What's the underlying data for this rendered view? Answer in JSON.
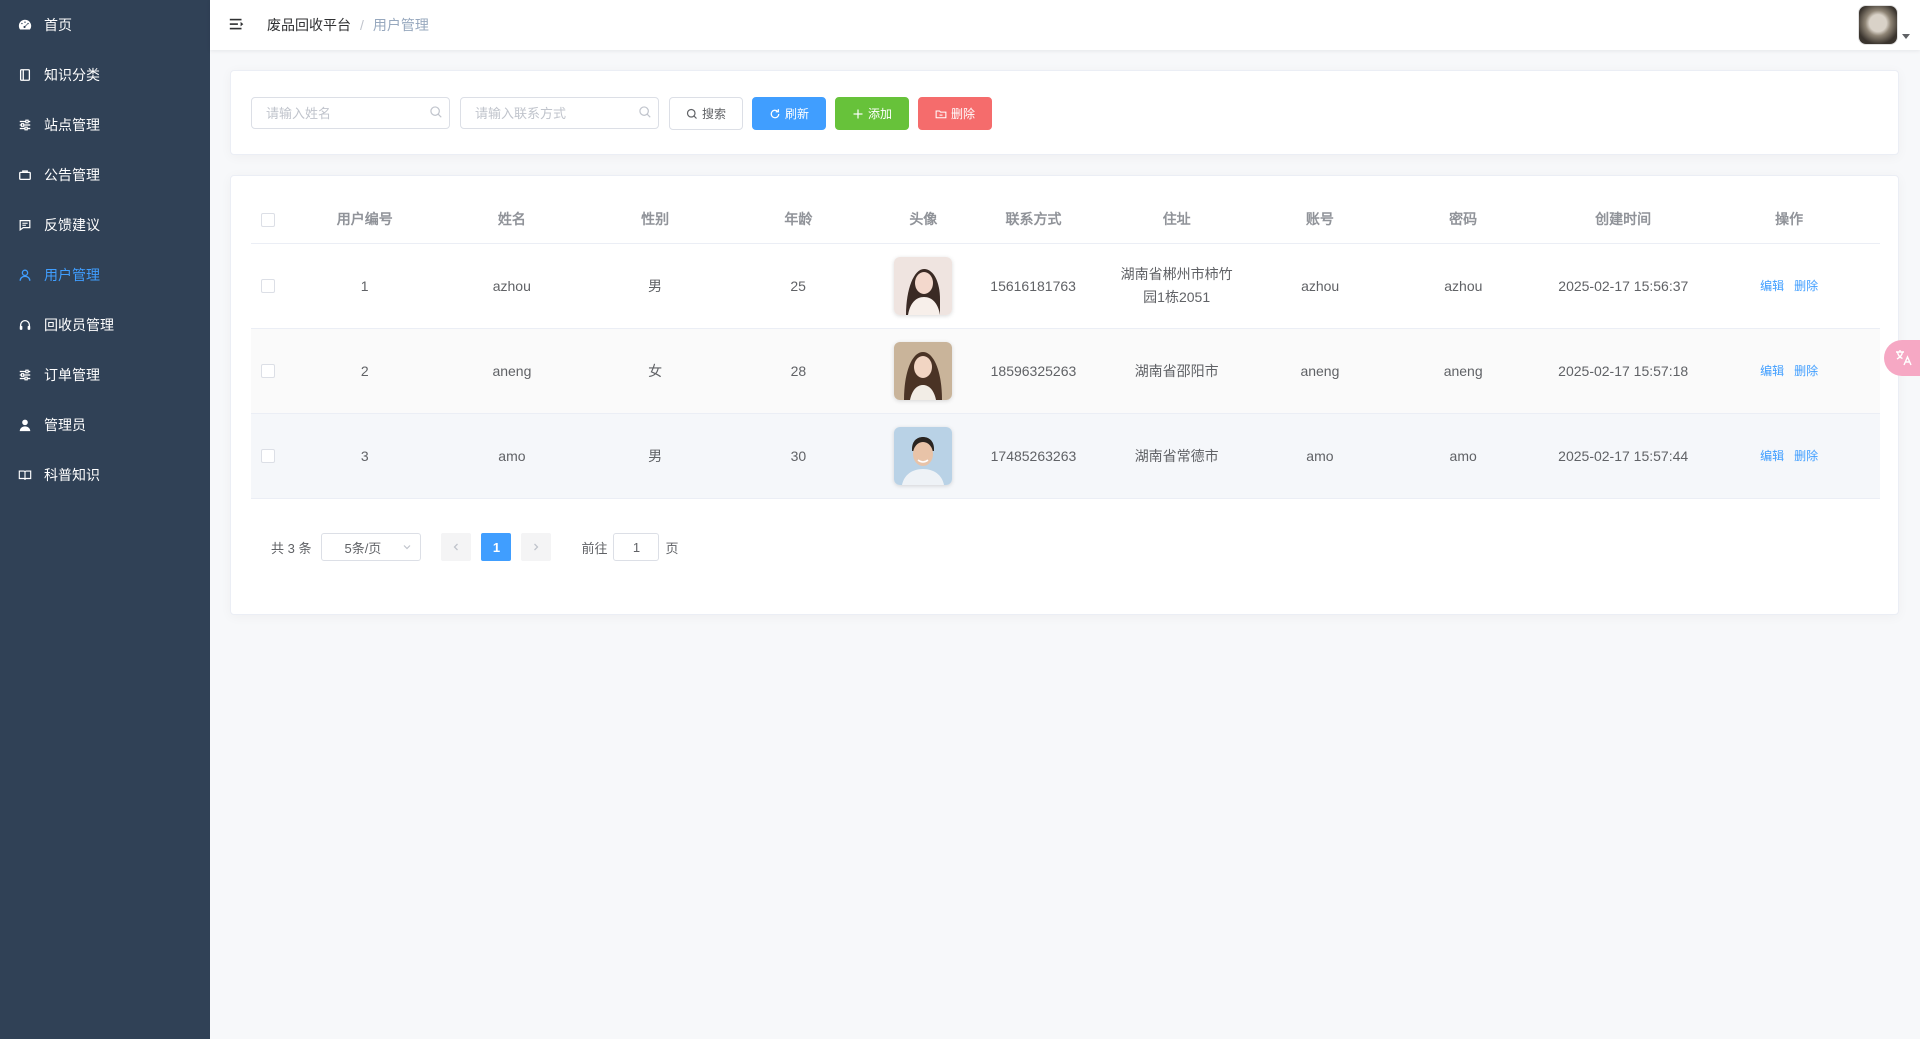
{
  "sidebar": {
    "items": [
      {
        "label": "首页",
        "icon": "dashboard-icon",
        "active": false
      },
      {
        "label": "知识分类",
        "icon": "book-icon",
        "active": false
      },
      {
        "label": "站点管理",
        "icon": "sliders-icon",
        "active": false
      },
      {
        "label": "公告管理",
        "icon": "briefcase-icon",
        "active": false
      },
      {
        "label": "反馈建议",
        "icon": "message-icon",
        "active": false
      },
      {
        "label": "用户管理",
        "icon": "user-icon",
        "active": true
      },
      {
        "label": "回收员管理",
        "icon": "headset-icon",
        "active": false
      },
      {
        "label": "订单管理",
        "icon": "sliders-icon",
        "active": false
      },
      {
        "label": "管理员",
        "icon": "user-solid-icon",
        "active": false
      },
      {
        "label": "科普知识",
        "icon": "open-book-icon",
        "active": false
      }
    ],
    "colors": {
      "bg": "#304156",
      "text": "#ffffff",
      "active": "#409eff"
    }
  },
  "header": {
    "breadcrumb_home": "废品回收平台",
    "breadcrumb_sep": "/",
    "breadcrumb_current": "用户管理"
  },
  "search": {
    "name_placeholder": "请输入姓名",
    "phone_placeholder": "请输入联系方式",
    "search_label": "搜索",
    "refresh_label": "刷新",
    "add_label": "添加",
    "delete_label": "删除"
  },
  "table": {
    "columns": [
      "用户编号",
      "姓名",
      "性别",
      "年龄",
      "头像",
      "联系方式",
      "住址",
      "账号",
      "密码",
      "创建时间",
      "操作"
    ],
    "rows": [
      {
        "id": "1",
        "name": "azhou",
        "gender": "男",
        "age": "25",
        "avatar": "woman-photo-1",
        "phone": "15616181763",
        "address": "湖南省郴州市柿竹园1栋2051",
        "account": "azhou",
        "password": "azhou",
        "created": "2025-02-17 15:56:37",
        "edit": "编辑",
        "del": "删除"
      },
      {
        "id": "2",
        "name": "aneng",
        "gender": "女",
        "age": "28",
        "avatar": "woman-photo-2",
        "phone": "18596325263",
        "address": "湖南省邵阳市",
        "account": "aneng",
        "password": "aneng",
        "created": "2025-02-17 15:57:18",
        "edit": "编辑",
        "del": "删除"
      },
      {
        "id": "3",
        "name": "amo",
        "gender": "男",
        "age": "30",
        "avatar": "man-photo",
        "phone": "17485263263",
        "address": "湖南省常德市",
        "account": "amo",
        "password": "amo",
        "created": "2025-02-17 15:57:44",
        "edit": "编辑",
        "del": "删除"
      }
    ]
  },
  "pagination": {
    "total": "共 3 条",
    "page_size": "5条/页",
    "current_page": "1",
    "goto_prefix": "前往",
    "goto_value": "1",
    "goto_suffix": "页"
  },
  "colors": {
    "primary": "#409eff",
    "success": "#67c23a",
    "danger": "#f56c6c"
  }
}
